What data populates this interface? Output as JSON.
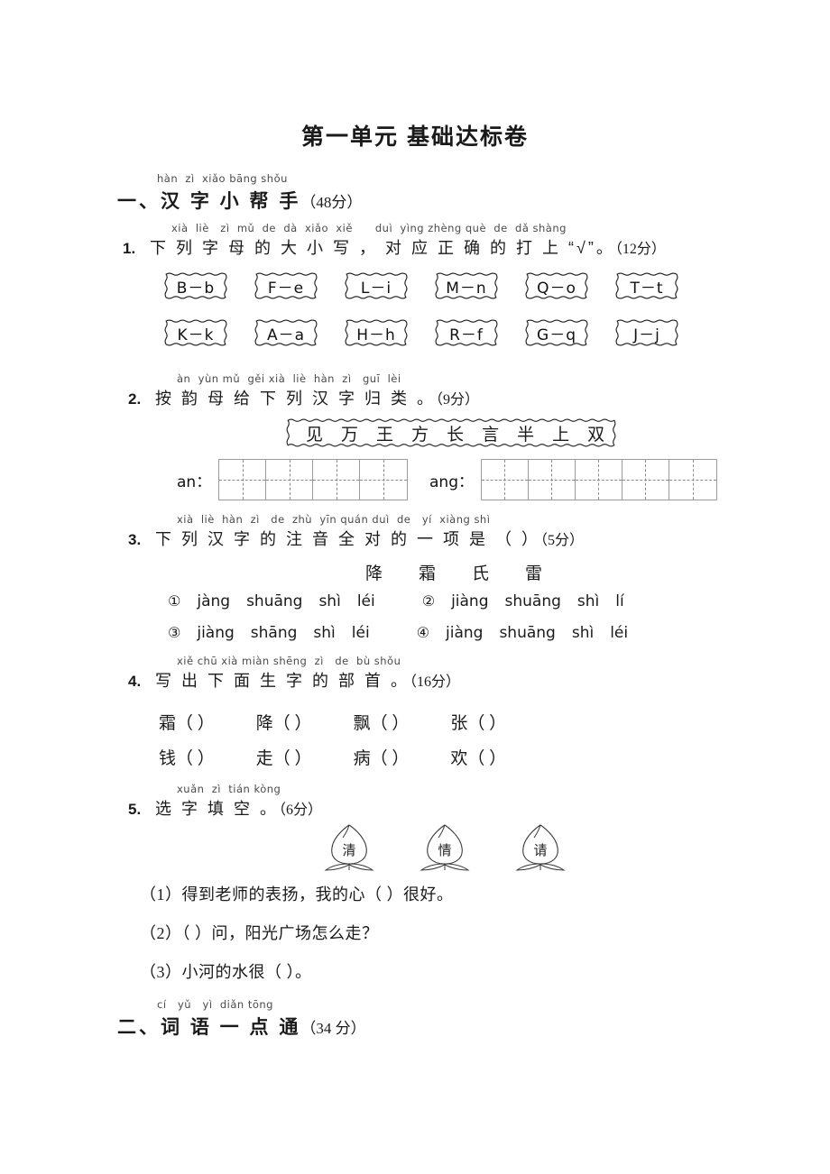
{
  "document": {
    "title": "第一单元 基础达标卷"
  },
  "sections": [
    {
      "index": "一、",
      "pinyin": "hàn  zì  xiǎo bāng shǒu",
      "title": "汉 字 小  帮  手",
      "points": "（48分）"
    },
    {
      "index": "二、",
      "pinyin": "cí   yǔ   yì  diǎn tōng",
      "title": "词 语 一 点  通",
      "points": "（34 分）"
    }
  ],
  "questions": {
    "q1": {
      "number": "1.",
      "pinyin": "xià  liè   zì  mǔ  de  dà  xiǎo  xiě      duì  yìng zhèng què  de  dǎ shàng",
      "text": "下 列 字 母 的 大 小 写 ， 对 应  正  确 的 打  上   “√”。",
      "points": "（12分）",
      "letter_pairs_row1": [
        "B－b",
        "F－e",
        "L－i",
        "M－n",
        "Q－o",
        "T－t"
      ],
      "letter_pairs_row2": [
        "K－k",
        "A－a",
        "H－h",
        "R－f",
        "G－q",
        "J－j"
      ]
    },
    "q2": {
      "number": "2.",
      "pinyin": "àn  yùn mǔ  gěi xià  liè  hàn  zì   guī  lèi",
      "text": "按 韵 母 给 下 列 汉 字 归 类 。",
      "points": "（9分）",
      "characters": [
        "见",
        "万",
        "王",
        "方",
        "长",
        "言",
        "半",
        "上",
        "双"
      ],
      "group_a_label": "an：",
      "group_a_cells": 4,
      "group_b_label": "ang：",
      "group_b_cells": 5
    },
    "q3": {
      "number": "3.",
      "pinyin": "xià  liè  hàn  zì   de  zhù  yīn quán duì  de   yí  xiàng shì",
      "text": "下 列 汉 字 的 注 音 全 对 的 一  项 是 （      ）",
      "points": "（5分）",
      "characters": [
        "降",
        "霜",
        "氏",
        "雷"
      ],
      "options": [
        {
          "marker": "①",
          "syllables": [
            "jàng",
            "shuāng",
            "shì",
            "léi"
          ]
        },
        {
          "marker": "②",
          "syllables": [
            "jiàng",
            "shuāng",
            "shì",
            "lí"
          ]
        },
        {
          "marker": "③",
          "syllables": [
            "jiàng",
            "shāng",
            "shì",
            "léi"
          ]
        },
        {
          "marker": "④",
          "syllables": [
            "jiàng",
            "shuāng",
            "shì",
            "léi"
          ]
        }
      ]
    },
    "q4": {
      "number": "4.",
      "pinyin": "xiě chū xià miàn shēng  zì   de  bù shǒu",
      "text": "写 出 下 面  生  字 的 部 首 。",
      "points": "（16分）",
      "row1": [
        "霜",
        "降",
        "飘",
        "张"
      ],
      "row2": [
        "钱",
        "走",
        "病",
        "欢"
      ],
      "blank": "（      ）"
    },
    "q5": {
      "number": "5.",
      "pinyin": "xuǎn  zì  tián kòng",
      "text": "选 字 填 空 。",
      "points": "（6分）",
      "leaf_characters": [
        "清",
        "情",
        "请"
      ],
      "sentences": [
        "（1）得到老师的表扬，我的心（      ）很好。",
        "（2）（      ）问，阳光广场怎么走？",
        "（3）小河的水很（      ）。"
      ]
    }
  },
  "colors": {
    "ink": "#1a1a1a",
    "grid_line": "#9a9a9a",
    "pinyin_gray": "#4a4a4a"
  }
}
